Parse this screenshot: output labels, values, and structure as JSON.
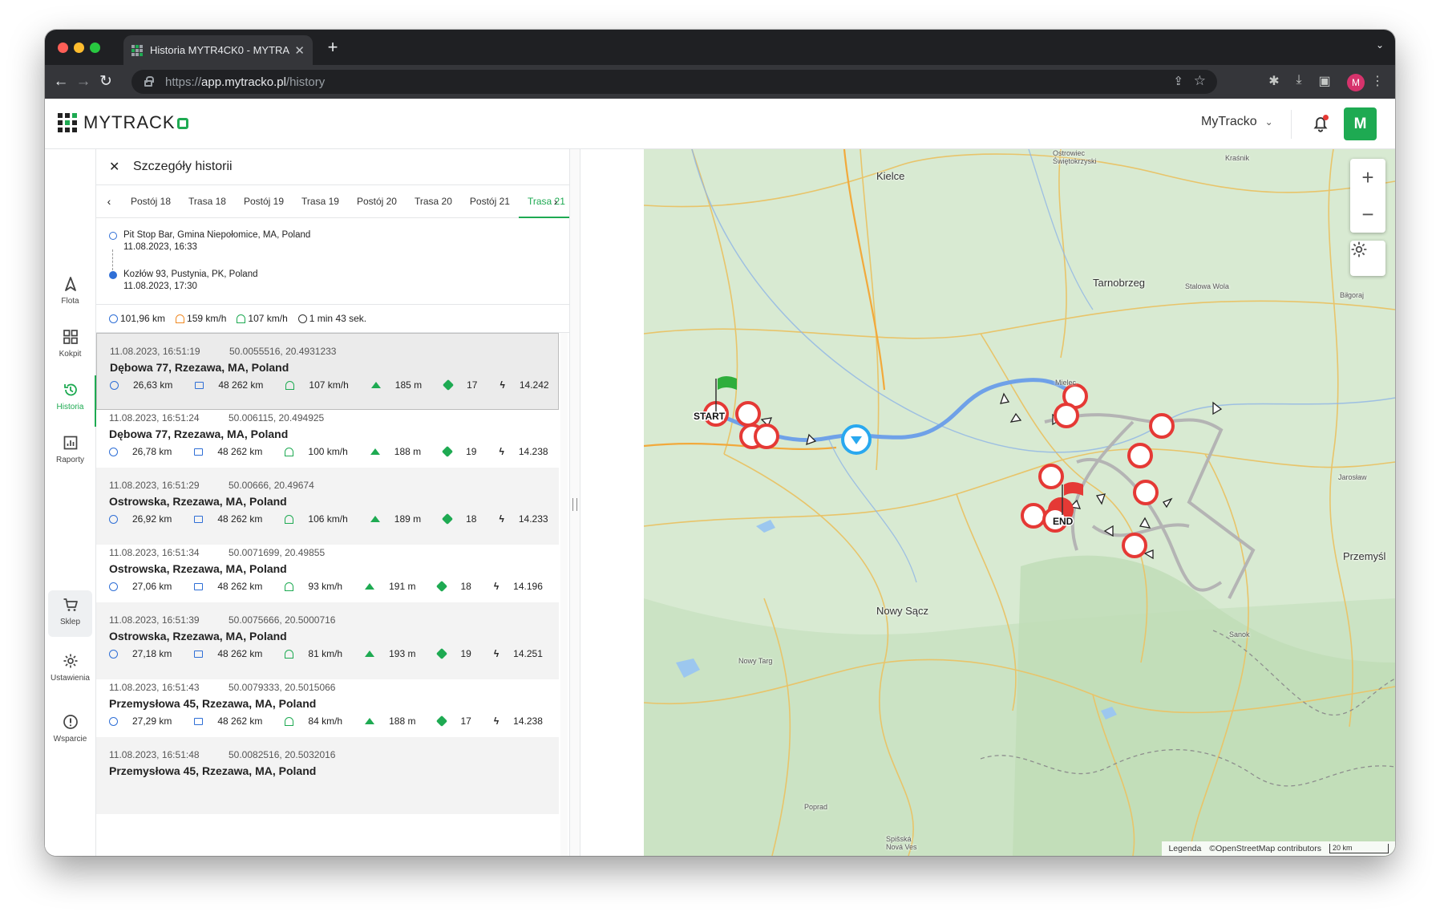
{
  "browser": {
    "tab_title": "Historia MYTR4CK0 - MYTRAC",
    "url_scheme": "https://",
    "url_host": "app.mytracko.pl",
    "url_path": "/history",
    "profile_initial": "M"
  },
  "app": {
    "logo_text": "MYTRACK",
    "account_name": "MyTracko",
    "avatar_initial": "M",
    "accent_color": "#1eaa52"
  },
  "sidebar": {
    "items": [
      {
        "label": "Flota",
        "icon": "navigation-arrow-icon"
      },
      {
        "label": "Kokpit",
        "icon": "grid-icon"
      },
      {
        "label": "Historia",
        "icon": "history-icon"
      },
      {
        "label": "Raporty",
        "icon": "report-icon"
      },
      {
        "label": "Sklep",
        "icon": "cart-icon"
      },
      {
        "label": "Ustawienia",
        "icon": "gear-icon"
      },
      {
        "label": "Wsparcie",
        "icon": "info-icon"
      }
    ]
  },
  "panel": {
    "title": "Szczegóły historii",
    "tabs": [
      "Postój 18",
      "Trasa 18",
      "Postój 19",
      "Trasa 19",
      "Postój 20",
      "Trasa 20",
      "Postój 21",
      "Trasa 21"
    ],
    "active_tab": "Trasa 21",
    "route": {
      "start_address": "Pit Stop Bar, Gmina Niepołomice, MA, Poland",
      "start_time": "11.08.2023, 16:33",
      "end_address": "Kozłów 93, Pustynia, PK, Poland",
      "end_time": "11.08.2023, 17:30"
    },
    "summary": {
      "distance": "101,96 km",
      "max_speed": "159 km/h",
      "avg_speed": "107 km/h",
      "duration": "1 min 43 sek."
    },
    "records": [
      {
        "time": "11.08.2023, 16:51:19",
        "coords": "50.0055516, 20.4931233",
        "address": "Dębowa 77, Rzezawa, MA, Poland",
        "distance": "26,63 km",
        "odometer": "48 262 km",
        "speed": "107 km/h",
        "altitude": "185 m",
        "satellites": "17",
        "voltage": "14.242"
      },
      {
        "time": "11.08.2023, 16:51:24",
        "coords": "50.006115, 20.494925",
        "address": "Dębowa 77, Rzezawa, MA, Poland",
        "distance": "26,78 km",
        "odometer": "48 262 km",
        "speed": "100 km/h",
        "altitude": "188 m",
        "satellites": "19",
        "voltage": "14.238"
      },
      {
        "time": "11.08.2023, 16:51:29",
        "coords": "50.00666, 20.49674",
        "address": "Ostrowska, Rzezawa, MA, Poland",
        "distance": "26,92 km",
        "odometer": "48 262 km",
        "speed": "106 km/h",
        "altitude": "189 m",
        "satellites": "18",
        "voltage": "14.233"
      },
      {
        "time": "11.08.2023, 16:51:34",
        "coords": "50.0071699, 20.49855",
        "address": "Ostrowska, Rzezawa, MA, Poland",
        "distance": "27,06 km",
        "odometer": "48 262 km",
        "speed": "93 km/h",
        "altitude": "191 m",
        "satellites": "18",
        "voltage": "14.196"
      },
      {
        "time": "11.08.2023, 16:51:39",
        "coords": "50.0075666, 20.5000716",
        "address": "Ostrowska, Rzezawa, MA, Poland",
        "distance": "27,18 km",
        "odometer": "48 262 km",
        "speed": "81 km/h",
        "altitude": "193 m",
        "satellites": "19",
        "voltage": "14.251"
      },
      {
        "time": "11.08.2023, 16:51:43",
        "coords": "50.0079333, 20.5015066",
        "address": "Przemysłowa 45, Rzezawa, MA, Poland",
        "distance": "27,29 km",
        "odometer": "48 262 km",
        "speed": "84 km/h",
        "altitude": "188 m",
        "satellites": "17",
        "voltage": "14.238"
      },
      {
        "time": "11.08.2023, 16:51:48",
        "coords": "50.0082516, 20.5032016",
        "address": "Przemysłowa 45, Rzezawa, MA, Poland",
        "distance": "",
        "odometer": "",
        "speed": "",
        "altitude": "",
        "satellites": "",
        "voltage": ""
      }
    ]
  },
  "map": {
    "labels": {
      "kielce": "Kielce",
      "tarnobrzeg": "Tarnobrzeg",
      "nowy_sacz": "Nowy Sącz",
      "przemysl": "Przemyśl",
      "mielec": "Mielec",
      "stalowa_wola": "Stalowa Wola",
      "bilgoraj": "Biłgoraj",
      "jaroslaw": "Jarosław",
      "sanok": "Sanok",
      "nowy_targ": "Nowy Targ",
      "poprad": "Poprad",
      "ostrowiec": "Ostrowiec Świętokrzyski",
      "krasnik": "Kraśnik",
      "spisska": "Spišská Nová Ves"
    },
    "start_label": "START",
    "end_label": "END",
    "legend": "Legenda",
    "attribution": "©OpenStreetMap contributors",
    "scale": "20 km",
    "route_color": "#6fa1e8",
    "marker_color": "#e53935"
  }
}
